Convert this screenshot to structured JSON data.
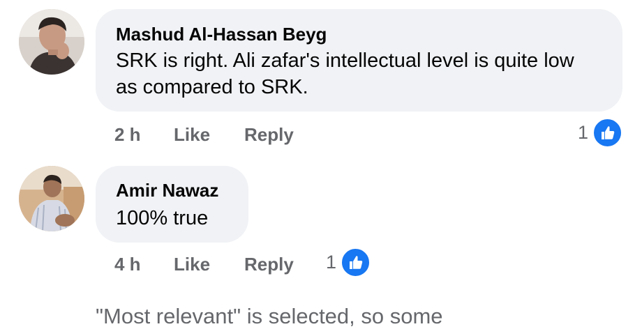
{
  "comments": [
    {
      "author": "Mashud Al-Hassan Beyg",
      "text": "SRK is right. Ali zafar's intellectual level is quite low as compared to SRK.",
      "time": "2 h",
      "like_label": "Like",
      "reply_label": "Reply",
      "reaction_count": "1",
      "reaction_icon": "thumbs-up-icon",
      "avatar_icon": "user-avatar"
    },
    {
      "author": "Amir Nawaz",
      "text": "100% true",
      "time": "4 h",
      "like_label": "Like",
      "reply_label": "Reply",
      "reaction_count": "1",
      "reaction_icon": "thumbs-up-icon",
      "avatar_icon": "user-avatar"
    }
  ],
  "footer_note": "\"Most relevant\" is selected, so some",
  "colors": {
    "bubble": "#f0f2f5",
    "meta_text": "#65676b",
    "like_blue": "#1877f2",
    "name_text": "#050505"
  }
}
